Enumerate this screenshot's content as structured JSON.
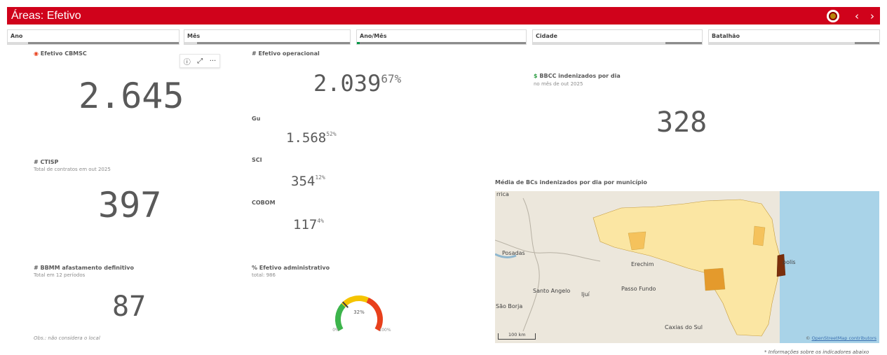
{
  "app": {
    "title": "Áreas: Efetivo",
    "prev_label": "‹",
    "next_label": "›"
  },
  "filters": [
    {
      "label": "Ano"
    },
    {
      "label": "Mês"
    },
    {
      "label": "Ano/Mês"
    },
    {
      "label": "Cidade"
    },
    {
      "label": "Batalhão"
    }
  ],
  "toolbar": {
    "info_icon": "ⓘ",
    "expand_icon": "⤢",
    "more_icon": "···"
  },
  "efetivo_cbmsc": {
    "title": "Efetivo CBMSC",
    "icon": "firefighter-icon",
    "value": "2.645"
  },
  "ctisp": {
    "title": "# CTISP",
    "subtitle": "Total de contratos em out 2025",
    "value": "397"
  },
  "bbmm": {
    "title": "# BBMM afastamento definitivo",
    "subtitle": "Total em 12 períodos",
    "value": "87",
    "note": "Obs.: não considera o local"
  },
  "operacional": {
    "title": "# Efetivo operacional",
    "value": "2.039",
    "pct": "67%",
    "items": [
      {
        "label": "Gu",
        "value": "1.568",
        "pct": "52%"
      },
      {
        "label": "SCI",
        "value": "354",
        "pct": "12%"
      },
      {
        "label": "COBOM",
        "value": "117",
        "pct": "4%"
      }
    ]
  },
  "administrativo": {
    "title": "% Efetivo administrativo",
    "subtitle": "total: 986",
    "gauge_value": "32%",
    "gauge_fraction": 0.32,
    "min_label": "0%",
    "max_label": "100%",
    "colors": {
      "green": "#3cb44b",
      "yellow": "#f5c400",
      "red": "#e8401c",
      "needle": "#404040"
    }
  },
  "bbcc": {
    "icon": "dollar-icon",
    "title": "BBCC indenizados por dia",
    "subtitle": "no mês de out 2025",
    "value": "328"
  },
  "map": {
    "title": "Média de BCs indenizados por dia por município",
    "labels": {
      "rrica": "rrica",
      "posadas": "Posadas",
      "erechim": "Erechim",
      "polis": "polis",
      "santo_angelo": "Santo Angelo",
      "ijui": "Ijuí",
      "passo_fundo": "Passo Fundo",
      "sao_borja": "São Borja",
      "caxias": "Caxias do Sul"
    },
    "scale_label": "100 km",
    "attribution_c": "©",
    "attribution": "OpenStreetMap contributors",
    "colors": {
      "sea": "#a9d3e8",
      "land": "#ece7dc",
      "low": "#fbe6a3",
      "mid": "#f5c25c",
      "high": "#e49a2c",
      "max": "#7a2e0b"
    }
  },
  "footnote": "* Informações sobre os indicadores abaixo"
}
